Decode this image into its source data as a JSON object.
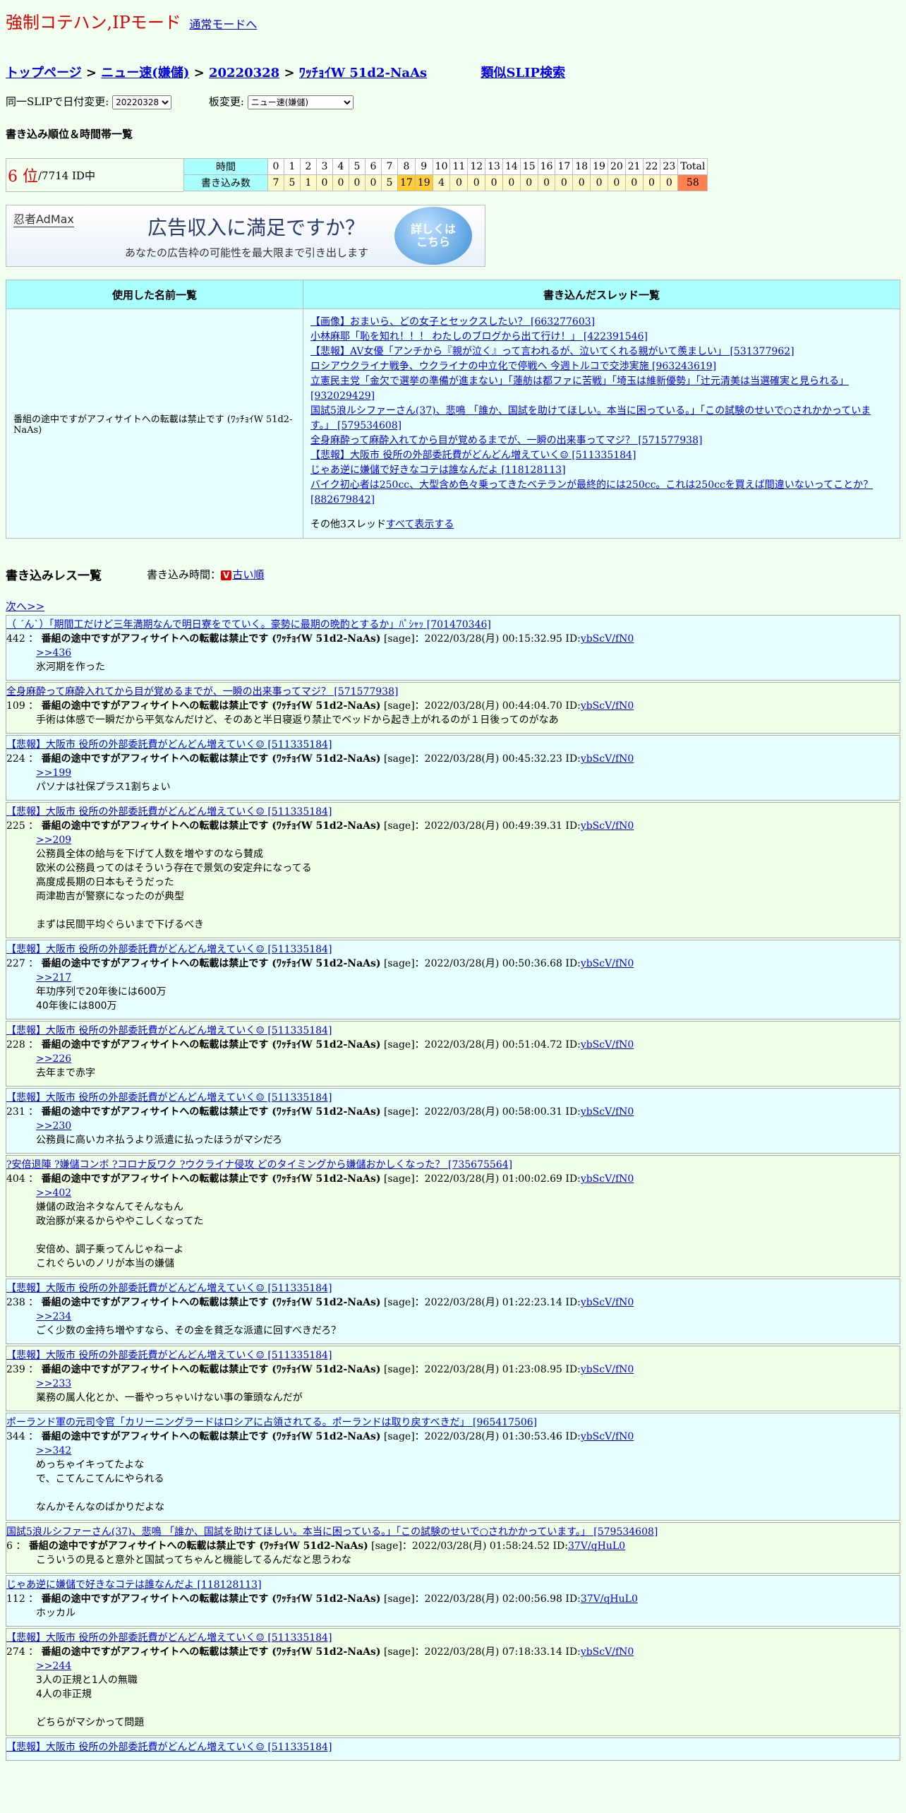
{
  "mode": {
    "title": "強制コテハン,IPモード",
    "normal_link": "通常モードへ"
  },
  "breadcrumb": {
    "top": "トップページ",
    "sep": ">",
    "board": "ニュー速(嫌儲)",
    "date": "20220328",
    "slip": "ﾜｯﾁｮｲW 51d2-NaAs",
    "similar": "類似SLIP検索"
  },
  "controls": {
    "date_label": "同一SLIPで日付変更:",
    "date_value": "20220328",
    "board_label": "板変更:",
    "board_value": "ニュー速(嫌儲)"
  },
  "rank_section": {
    "title": "書き込み順位＆時間帯一覧"
  },
  "rank": {
    "rank": "6 位",
    "total": "/7714 ID中"
  },
  "hours_table": {
    "time_label": "時間",
    "count_label": "書き込み数",
    "total_label": "Total",
    "hours": [
      "0",
      "1",
      "2",
      "3",
      "4",
      "5",
      "6",
      "7",
      "8",
      "9",
      "10",
      "11",
      "12",
      "13",
      "14",
      "15",
      "16",
      "17",
      "18",
      "19",
      "20",
      "21",
      "22",
      "23"
    ],
    "counts": [
      "7",
      "5",
      "1",
      "0",
      "0",
      "0",
      "0",
      "5",
      "17",
      "19",
      "4",
      "0",
      "0",
      "0",
      "0",
      "0",
      "0",
      "0",
      "0",
      "0",
      "0",
      "0",
      "0",
      "0"
    ],
    "total": "58"
  },
  "ad": {
    "logo": "忍者AdMax",
    "headline": "広告収入に満足ですか？",
    "sub": "あなたの広告枠の可能性を最大限まで引き出します",
    "button": "詳しくはこちら"
  },
  "names_table": {
    "col_names": "使用した名前一覧",
    "col_threads": "書き込んだスレッド一覧",
    "name": "番組の途中ですがアフィサイトへの転載は禁止です (ﾜｯﾁｮｲW 51d2-NaAs)",
    "threads": [
      "【画像】おまいら、どの女子とセックスしたい？ [663277603]",
      "小林麻耶「恥を知れ！！！ わたしのブログから出て行け！」 [422391546]",
      "【悲報】AV女優「アンチから『親が泣く』って言われるが、泣いてくれる親がいて羨ましい」 [531377962]",
      "ロシアウクライナ戦争、ウクライナの中立化で停戦へ 今週トルコで交渉実施 [963243619]",
      "立憲民主党「金欠で選挙の準備が進まない」「蓮舫は都ファに苦戦」「埼玉は維新優勢」「辻元清美は当選確実と見られる」 [932029429]",
      "国試5浪ルシファーさん(37)、悲鳴 「誰か、国試を助けてほしい。本当に困っている。」「この試験のせいで○されかかっています。」 [579534608]",
      "全身麻酔って麻酔入れてから目が覚めるまでが、一瞬の出来事ってマジ？ [571577938]",
      "【悲報】大阪市 役所の外部委託費がどんどん増えていく☺ [511335184]",
      "じゃあ逆に嫌儲で好きなコテは誰なんだよ [118128113]",
      "バイク初心者は250cc、大型含め色々乗ってきたベテランが最終的には250cc。これは250ccを買えば間違いないってことか？ [882679842]"
    ],
    "more_prefix": "その他3スレッド",
    "more_link": "すべて表示する"
  },
  "posts_section": {
    "title": "書き込みレス一覧",
    "time_label": "書き込み時間：",
    "order_icon": "V",
    "order_link": "古い順",
    "next": "次へ>>"
  },
  "posts": [
    {
      "thread": "（ ´ん`）「期間工だけど三年満期なんで明日寮をでていく。豪勢に最期の晩酌とするか」ﾊﾟｼｬｯ [701470346]",
      "no": "442",
      "name": "番組の途中ですがアフィサイトへの転載は禁止です (ﾜｯﾁｮｲW 51d2-NaAs)",
      "meta": "[sage]：2022/03/28(月) 00:15:32.95 ID:",
      "id": "ybScV/fN0",
      "anchor": ">>436",
      "lines": [
        "氷河期を作った"
      ]
    },
    {
      "thread": "全身麻酔って麻酔入れてから目が覚めるまでが、一瞬の出来事ってマジ？ [571577938]",
      "no": "109",
      "name": "番組の途中ですがアフィサイトへの転載は禁止です (ﾜｯﾁｮｲW 51d2-NaAs)",
      "meta": "[sage]：2022/03/28(月) 00:44:04.70 ID:",
      "id": "ybScV/fN0",
      "anchor": "",
      "lines": [
        "手術は体感で一瞬だから平気なんだけど、そのあと半日寝返り禁止でベッドから起き上がれるのが１日後ってのがなあ"
      ]
    },
    {
      "thread": "【悲報】大阪市 役所の外部委託費がどんどん増えていく☺ [511335184]",
      "no": "224",
      "name": "番組の途中ですがアフィサイトへの転載は禁止です (ﾜｯﾁｮｲW 51d2-NaAs)",
      "meta": "[sage]：2022/03/28(月) 00:45:32.23 ID:",
      "id": "ybScV/fN0",
      "anchor": ">>199",
      "lines": [
        "パソナは社保プラス1割ちょい"
      ]
    },
    {
      "thread": "【悲報】大阪市 役所の外部委託費がどんどん増えていく☺ [511335184]",
      "no": "225",
      "name": "番組の途中ですがアフィサイトへの転載は禁止です (ﾜｯﾁｮｲW 51d2-NaAs)",
      "meta": "[sage]：2022/03/28(月) 00:49:39.31 ID:",
      "id": "ybScV/fN0",
      "anchor": ">>209",
      "lines": [
        "公務員全体の給与を下げて人数を増やすのなら賛成",
        "欧米の公務員ってのはそういう存在で景気の安定弁になってる",
        "高度成長期の日本もそうだった",
        "両津勘吉が警察になったのが典型",
        "",
        "まずは民間平均ぐらいまで下げるべき"
      ]
    },
    {
      "thread": "【悲報】大阪市 役所の外部委託費がどんどん増えていく☺ [511335184]",
      "no": "227",
      "name": "番組の途中ですがアフィサイトへの転載は禁止です (ﾜｯﾁｮｲW 51d2-NaAs)",
      "meta": "[sage]：2022/03/28(月) 00:50:36.68 ID:",
      "id": "ybScV/fN0",
      "anchor": ">>217",
      "lines": [
        "年功序列で20年後には600万",
        "40年後には800万"
      ]
    },
    {
      "thread": "【悲報】大阪市 役所の外部委託費がどんどん増えていく☺ [511335184]",
      "no": "228",
      "name": "番組の途中ですがアフィサイトへの転載は禁止です (ﾜｯﾁｮｲW 51d2-NaAs)",
      "meta": "[sage]：2022/03/28(月) 00:51:04.72 ID:",
      "id": "ybScV/fN0",
      "anchor": ">>226",
      "lines": [
        "去年まで赤字"
      ]
    },
    {
      "thread": "【悲報】大阪市 役所の外部委託費がどんどん増えていく☺ [511335184]",
      "no": "231",
      "name": "番組の途中ですがアフィサイトへの転載は禁止です (ﾜｯﾁｮｲW 51d2-NaAs)",
      "meta": "[sage]：2022/03/28(月) 00:58:00.31 ID:",
      "id": "ybScV/fN0",
      "anchor": ">>230",
      "lines": [
        "公務員に高いカネ払うより派遣に払ったほうがマシだろ"
      ]
    },
    {
      "thread": "?安倍退陣 ?嫌儲コンボ ?コロナ反ワク ?ウクライナ侵攻 どのタイミングから嫌儲おかしくなった？ [735675564]",
      "no": "404",
      "name": "番組の途中ですがアフィサイトへの転載は禁止です (ﾜｯﾁｮｲW 51d2-NaAs)",
      "meta": "[sage]：2022/03/28(月) 01:00:02.69 ID:",
      "id": "ybScV/fN0",
      "anchor": ">>402",
      "lines": [
        "嫌儲の政治ネタなんてそんなもん",
        "政治豚が来るからややこしくなってた",
        "",
        "安倍め、調子乗ってんじゃねーよ",
        "これぐらいのノリが本当の嫌儲"
      ]
    },
    {
      "thread": "【悲報】大阪市 役所の外部委託費がどんどん増えていく☺ [511335184]",
      "no": "238",
      "name": "番組の途中ですがアフィサイトへの転載は禁止です (ﾜｯﾁｮｲW 51d2-NaAs)",
      "meta": "[sage]：2022/03/28(月) 01:22:23.14 ID:",
      "id": "ybScV/fN0",
      "anchor": ">>234",
      "lines": [
        "ごく少数の金持ち増やすなら、その金を貧乏な派遣に回すべきだろ？"
      ]
    },
    {
      "thread": "【悲報】大阪市 役所の外部委託費がどんどん増えていく☺ [511335184]",
      "no": "239",
      "name": "番組の途中ですがアフィサイトへの転載は禁止です (ﾜｯﾁｮｲW 51d2-NaAs)",
      "meta": "[sage]：2022/03/28(月) 01:23:08.95 ID:",
      "id": "ybScV/fN0",
      "anchor": ">>233",
      "lines": [
        "業務の属人化とか、一番やっちゃいけない事の筆頭なんだが"
      ]
    },
    {
      "thread": "ポーランド軍の元司令官「カリーニングラードはロシアに占領されてる。ポーランドは取り戻すべきだ」 [965417506]",
      "no": "344",
      "name": "番組の途中ですがアフィサイトへの転載は禁止です (ﾜｯﾁｮｲW 51d2-NaAs)",
      "meta": "[sage]：2022/03/28(月) 01:30:53.46 ID:",
      "id": "ybScV/fN0",
      "anchor": ">>342",
      "lines": [
        "めっちゃイキってたよな",
        "で、こてんこてんにやられる",
        "",
        "なんかそんなのばかりだよな"
      ]
    },
    {
      "thread": "国試5浪ルシファーさん(37)、悲鳴 「誰か、国試を助けてほしい。本当に困っている。」「この試験のせいで○されかかっています。」 [579534608]",
      "no": "6",
      "name": "番組の途中ですがアフィサイトへの転載は禁止です (ﾜｯﾁｮｲW 51d2-NaAs)",
      "meta": "[sage]：2022/03/28(月) 01:58:24.52 ID:",
      "id": "37V/qHuL0",
      "anchor": "",
      "lines": [
        "こういうの見ると意外と国試ってちゃんと機能してるんだなと思うわな"
      ]
    },
    {
      "thread": "じゃあ逆に嫌儲で好きなコテは誰なんだよ [118128113]",
      "no": "112",
      "name": "番組の途中ですがアフィサイトへの転載は禁止です (ﾜｯﾁｮｲW 51d2-NaAs)",
      "meta": "[sage]：2022/03/28(月) 02:00:56.98 ID:",
      "id": "37V/qHuL0",
      "anchor": "",
      "lines": [
        "ホッカル"
      ]
    },
    {
      "thread": "【悲報】大阪市 役所の外部委託費がどんどん増えていく☺ [511335184]",
      "no": "274",
      "name": "番組の途中ですがアフィサイトへの転載は禁止です (ﾜｯﾁｮｲW 51d2-NaAs)",
      "meta": "[sage]：2022/03/28(月) 07:18:33.14 ID:",
      "id": "ybScV/fN0",
      "anchor": ">>244",
      "lines": [
        "3人の正規と1人の無職",
        "4人の非正規",
        "",
        "どちらがマシかって問題"
      ]
    },
    {
      "thread": "【悲報】大阪市 役所の外部委託費がどんどん増えていく☺ [511335184]",
      "no": "",
      "name": "",
      "meta": "",
      "id": "",
      "anchor": "",
      "lines": []
    }
  ]
}
